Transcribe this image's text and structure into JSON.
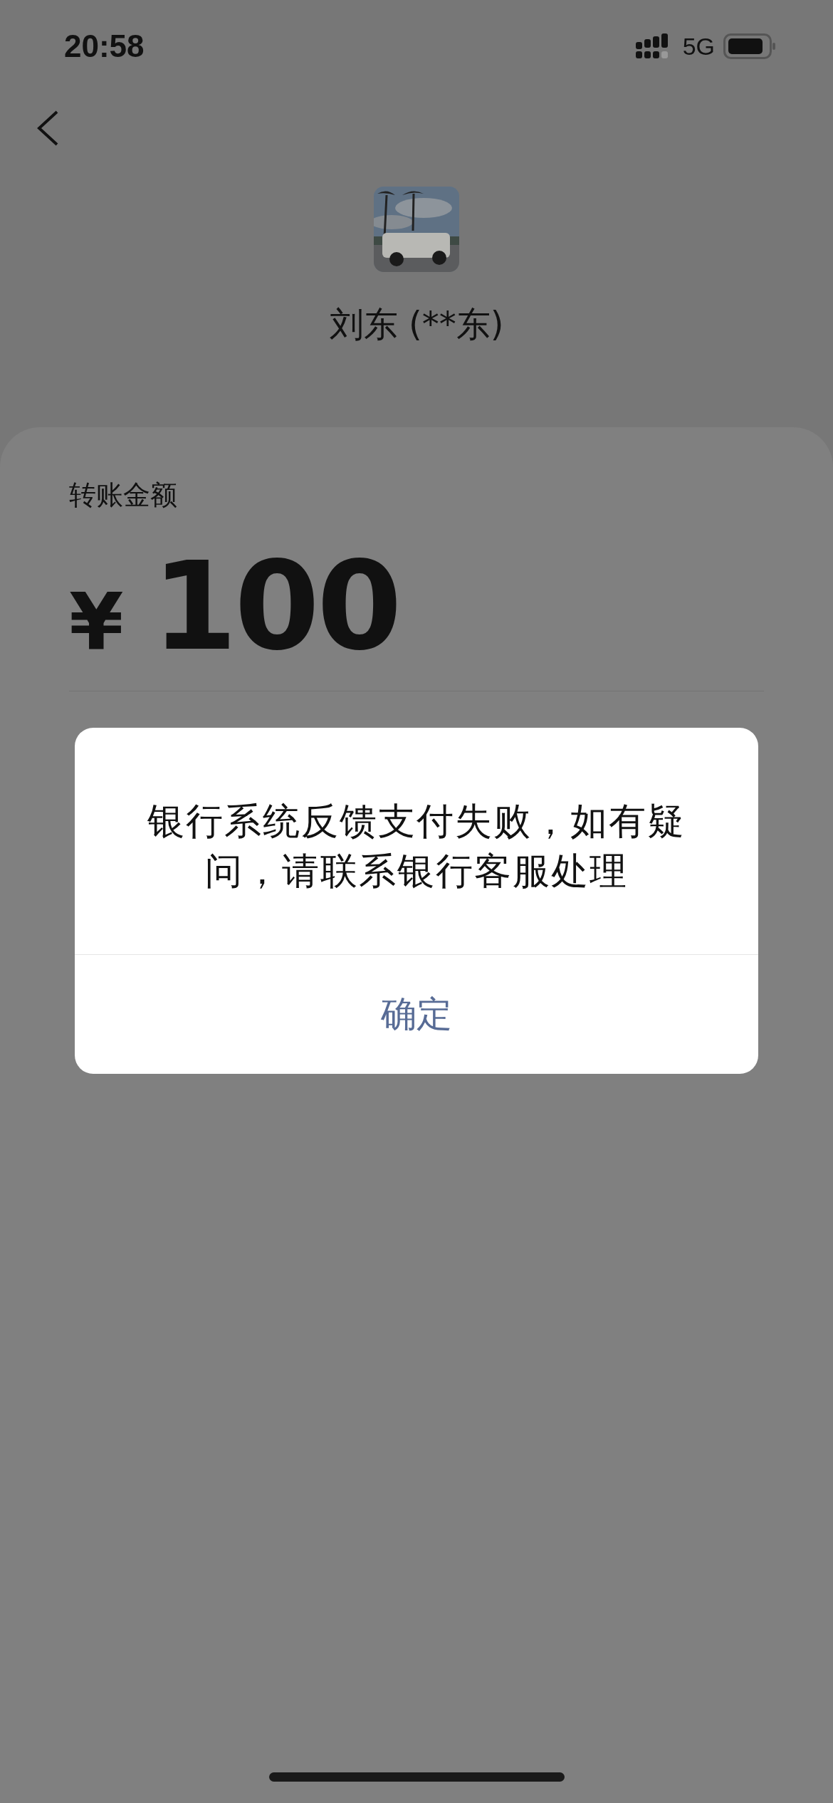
{
  "status_bar": {
    "time": "20:58",
    "network": "5G"
  },
  "header": {
    "name": "刘东 (**东)"
  },
  "amount_card": {
    "label": "转账金额",
    "currency": "¥",
    "amount": "100"
  },
  "dialog": {
    "message": "银行系统反馈支付失败，如有疑问，请联系银行客服处理",
    "buttons": [
      "确定"
    ]
  }
}
